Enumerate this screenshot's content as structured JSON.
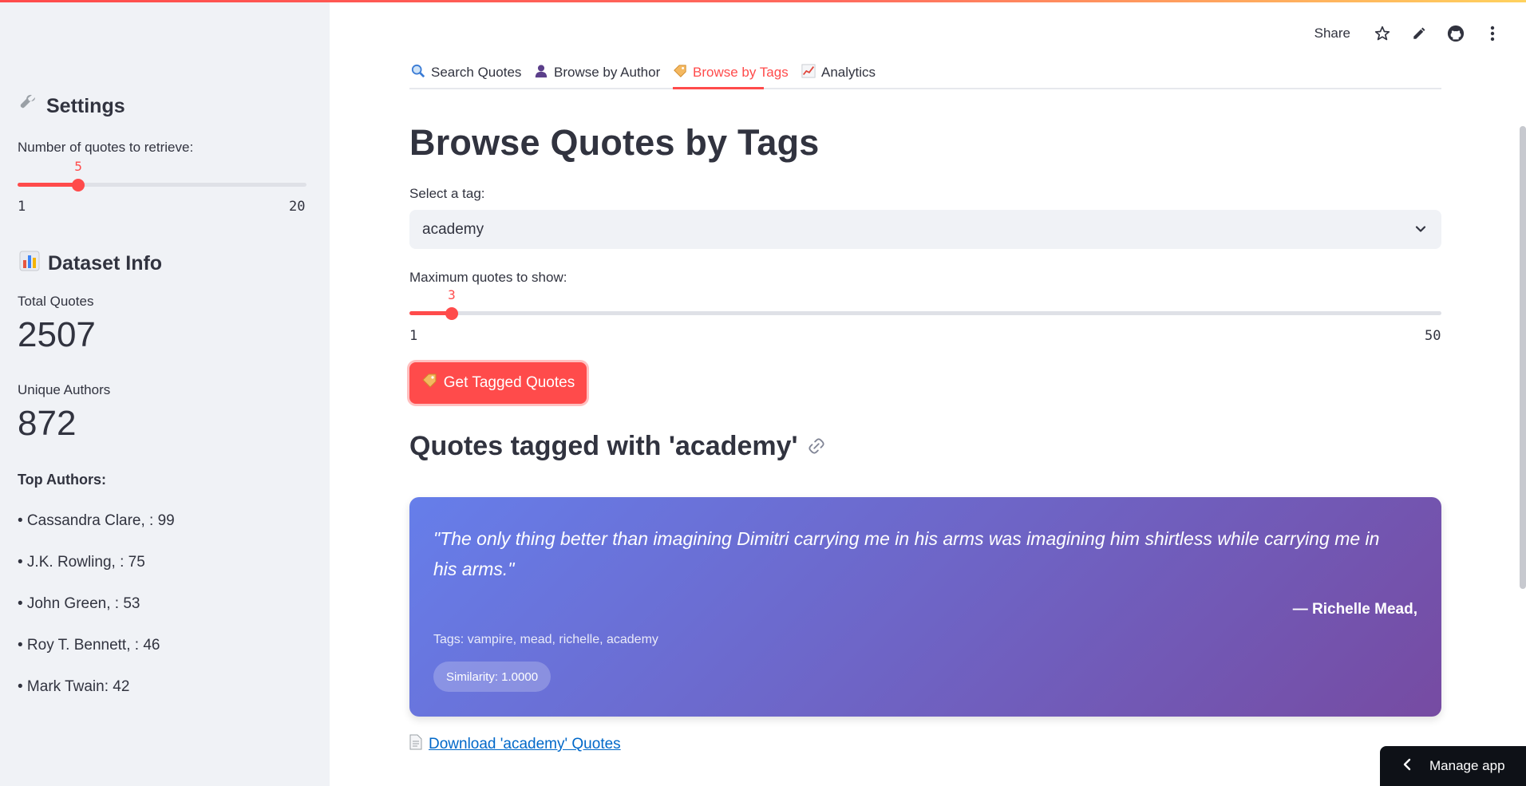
{
  "sidebar": {
    "settings_title": "Settings",
    "num_quotes_label": "Number of quotes to retrieve:",
    "num_quotes_slider": {
      "value": "5",
      "min": "1",
      "max": "20",
      "fraction": 0.21
    },
    "dataset_title": "Dataset Info",
    "total_quotes_label": "Total Quotes",
    "total_quotes_value": "2507",
    "unique_authors_label": "Unique Authors",
    "unique_authors_value": "872",
    "top_authors_title": "Top Authors:",
    "top_authors": [
      "• Cassandra Clare, : 99",
      "• J.K. Rowling, : 75",
      "• John Green, : 53",
      "• Roy T. Bennett, : 46",
      "• Mark Twain: 42"
    ]
  },
  "header": {
    "share_label": "Share",
    "icons": [
      "star-icon",
      "edit-icon",
      "github-icon",
      "more-vertical-icon"
    ]
  },
  "tabs": [
    {
      "label": "Search Quotes",
      "icon": "magnifier-icon"
    },
    {
      "label": "Browse by Author",
      "icon": "person-icon"
    },
    {
      "label": "Browse by Tags",
      "icon": "tag-icon",
      "active": true
    },
    {
      "label": "Analytics",
      "icon": "chart-icon"
    }
  ],
  "main": {
    "title": "Browse Quotes by Tags",
    "select_label": "Select a tag:",
    "select_value": "academy",
    "max_quotes_label": "Maximum quotes to show:",
    "max_quotes_slider": {
      "value": "3",
      "min": "1",
      "max": "50",
      "fraction": 0.041
    },
    "button_label": "Get Tagged Quotes",
    "results_heading": "Quotes tagged with 'academy'",
    "quote": {
      "text": "\"The only thing better than imagining Dimitri carrying me in his arms was imagining him shirtless while carrying me in his arms.\"",
      "author": "— Richelle Mead,",
      "tags": "Tags: vampire, mead, richelle, academy",
      "similarity": "Similarity: 1.0000"
    },
    "download_label": " Download 'academy' Quotes"
  },
  "footer": {
    "manage_app_label": "Manage app"
  },
  "colors": {
    "accent": "#ff4b4b",
    "link": "#0068c9",
    "card_start": "#667eea",
    "card_end": "#764ba2"
  }
}
